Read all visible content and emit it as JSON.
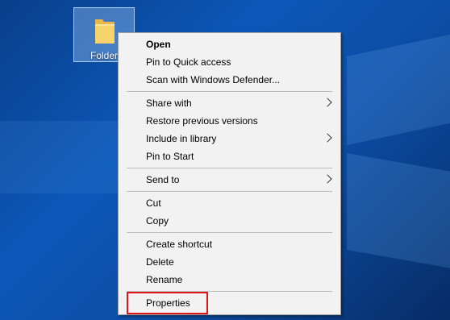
{
  "desktop": {
    "folder_label": "Folder"
  },
  "menu": {
    "groups": [
      [
        {
          "label": "Open",
          "bold": true,
          "submenu": false
        },
        {
          "label": "Pin to Quick access",
          "bold": false,
          "submenu": false
        },
        {
          "label": "Scan with Windows Defender...",
          "bold": false,
          "submenu": false
        }
      ],
      [
        {
          "label": "Share with",
          "bold": false,
          "submenu": true
        },
        {
          "label": "Restore previous versions",
          "bold": false,
          "submenu": false
        },
        {
          "label": "Include in library",
          "bold": false,
          "submenu": true
        },
        {
          "label": "Pin to Start",
          "bold": false,
          "submenu": false
        }
      ],
      [
        {
          "label": "Send to",
          "bold": false,
          "submenu": true
        }
      ],
      [
        {
          "label": "Cut",
          "bold": false,
          "submenu": false
        },
        {
          "label": "Copy",
          "bold": false,
          "submenu": false
        }
      ],
      [
        {
          "label": "Create shortcut",
          "bold": false,
          "submenu": false
        },
        {
          "label": "Delete",
          "bold": false,
          "submenu": false
        },
        {
          "label": "Rename",
          "bold": false,
          "submenu": false
        }
      ],
      [
        {
          "label": "Properties",
          "bold": false,
          "submenu": false
        }
      ]
    ]
  },
  "colors": {
    "highlight": "#e0141b",
    "menu_bg": "#f2f2f2",
    "desktop_bg": "#0b57b8"
  }
}
